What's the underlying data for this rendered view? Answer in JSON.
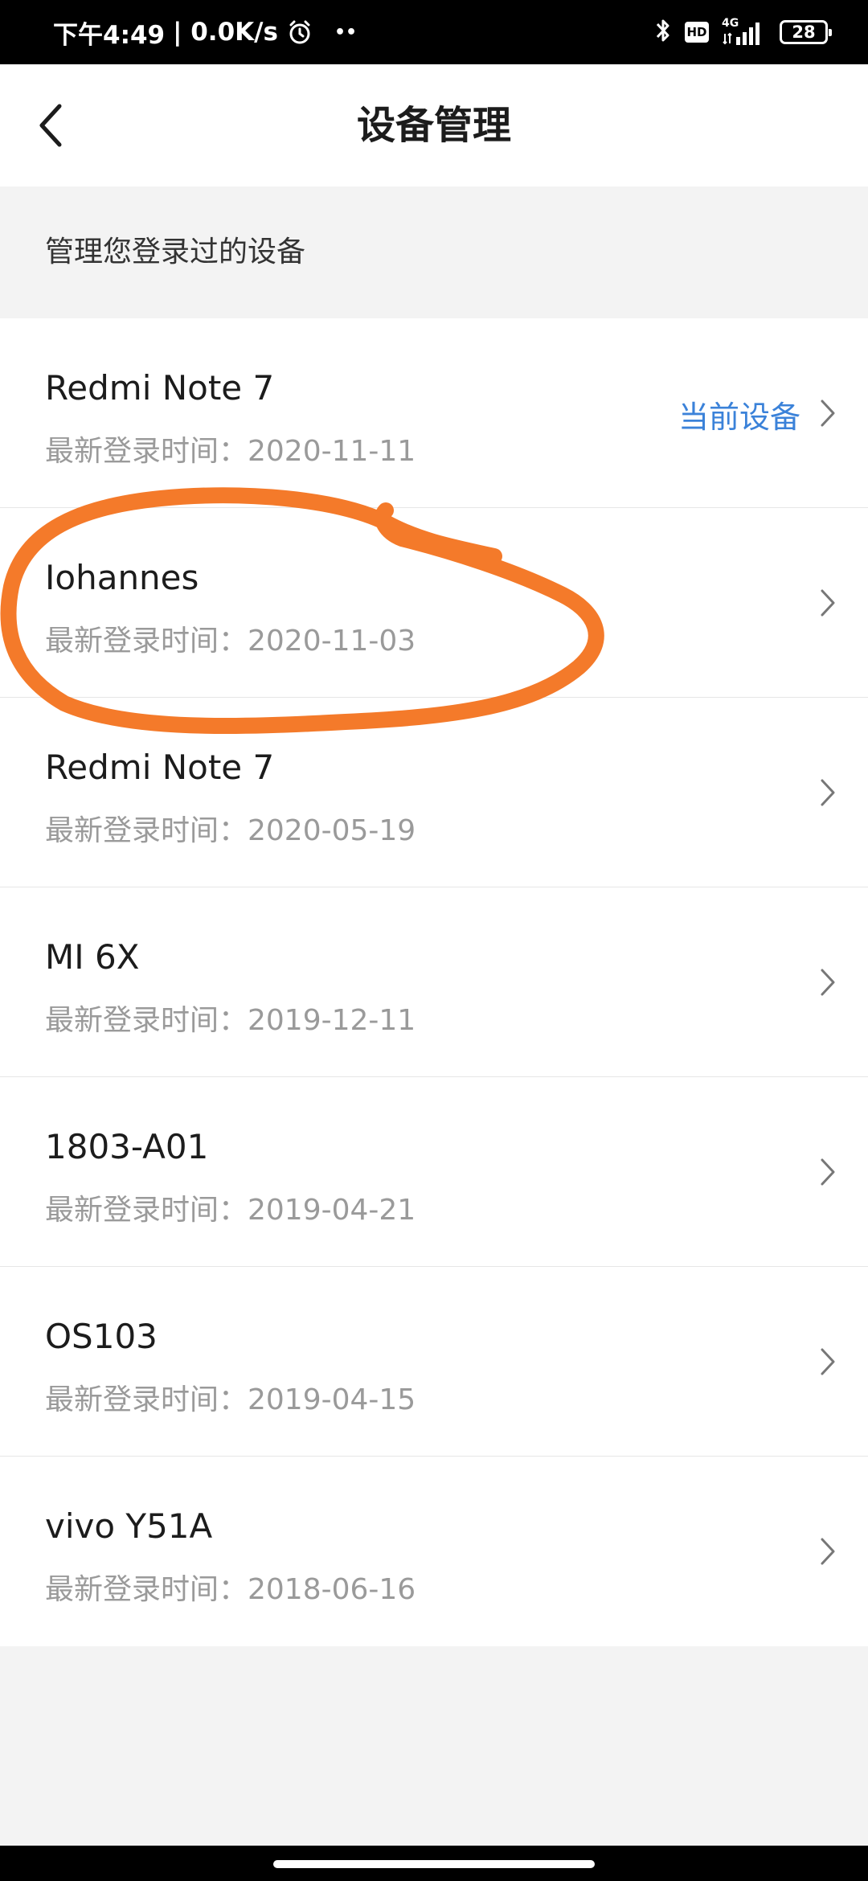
{
  "status_bar": {
    "time": "下午4:49",
    "network_speed": "| 0.0K/s",
    "more_dots": "••",
    "hd_label": "HD",
    "network_type": "4G",
    "battery_level": "28",
    "icons": [
      "alarm-icon",
      "bluetooth-icon",
      "hd-icon",
      "signal-icon",
      "battery-icon"
    ]
  },
  "nav": {
    "title": "设备管理",
    "back_icon": "chevron-left-icon"
  },
  "section": {
    "hint": "管理您登录过的设备"
  },
  "devices": [
    {
      "name": "Redmi Note 7",
      "time": "最新登录时间：2020-11-11",
      "tag": "当前设备"
    },
    {
      "name": "Iohannes",
      "time": "最新登录时间：2020-11-03"
    },
    {
      "name": "Redmi Note 7",
      "time": "最新登录时间：2020-05-19"
    },
    {
      "name": "MI 6X",
      "time": "最新登录时间：2019-12-11"
    },
    {
      "name": "1803-A01",
      "time": "最新登录时间：2019-04-21"
    },
    {
      "name": "OS103",
      "time": "最新登录时间：2019-04-15"
    },
    {
      "name": "vivo Y51A",
      "time": "最新登录时间：2018-06-16"
    }
  ],
  "colors": {
    "accent": "#3b82d9",
    "annotation": "#f47a2a",
    "page_background": "#f3f3f3",
    "secondary_text": "#9a9a9a"
  }
}
